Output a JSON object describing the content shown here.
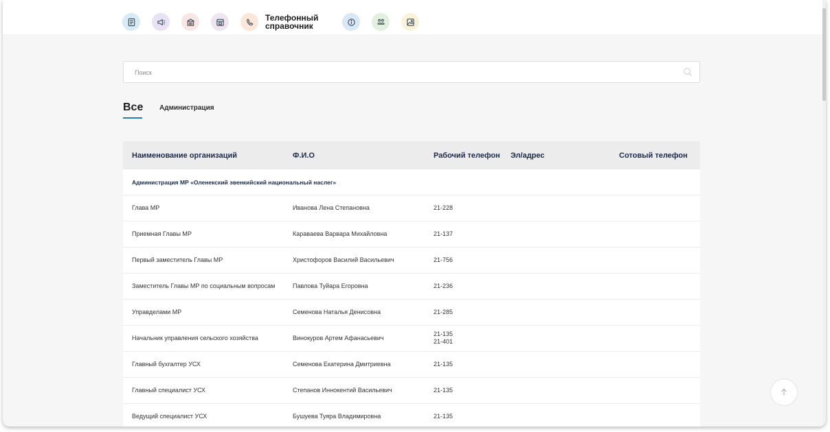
{
  "nav": {
    "items": [
      {
        "name": "documents-icon",
        "bg": "#d6ebf3"
      },
      {
        "name": "megaphone-icon",
        "bg": "#e8e2f4"
      },
      {
        "name": "building-icon",
        "bg": "#f7e6e4"
      },
      {
        "name": "calendar-icon",
        "bg": "#ede6f1"
      },
      {
        "name": "phone-icon",
        "bg": "#fbe7d8",
        "label": "Телефонный справочник"
      },
      {
        "name": "info-icon",
        "bg": "#d9e7f6"
      },
      {
        "name": "people-icon",
        "bg": "#e2f0df"
      },
      {
        "name": "image-icon",
        "bg": "#fbf3d9"
      }
    ]
  },
  "search": {
    "placeholder": "Поиск"
  },
  "tabs": {
    "all": "Все",
    "admin": "Администрация"
  },
  "table": {
    "headers": {
      "org": "Наименование организаций",
      "fio": "Ф.И.О",
      "work_phone": "Рабочий телефон",
      "email": "Эл/адрес",
      "mobile": "Сотовый телефон"
    },
    "group_title": "Администрация МР «Оленекский эвенкийский национальный наслег»",
    "rows": [
      {
        "org": "Глава МР",
        "fio": "Иванова Лена Степановна",
        "phone": "21-228",
        "phone2": ""
      },
      {
        "org": "Приемная Главы МР",
        "fio": "Караваева Варвара Михайловна",
        "phone": "21-137",
        "phone2": ""
      },
      {
        "org": "Первый заместитель Главы МР",
        "fio": "Христофоров Василий Васильевич",
        "phone": "21-756",
        "phone2": ""
      },
      {
        "org": "Заместитель Главы МР по социальным вопросам",
        "fio": "Павлова Туйара Егоровна",
        "phone": "21-236",
        "phone2": ""
      },
      {
        "org": "Управделами МР",
        "fio": "Семенова Наталья Денисовна",
        "phone": "21-285",
        "phone2": ""
      },
      {
        "org": "Начальник управления сельского хозяйства",
        "fio": "Винокуров Артем Афанасьевич",
        "phone": "21-135",
        "phone2": "21-401"
      },
      {
        "org": "Главный бухгалтер УСХ",
        "fio": "Семенова Екатерина Дмитриевна",
        "phone": "21-135",
        "phone2": ""
      },
      {
        "org": "Главный специалист УСХ",
        "fio": "Степанов Иннокентий Васильевич",
        "phone": "21-135",
        "phone2": ""
      },
      {
        "org": "Ведущий специалист УСХ",
        "fio": "Бушуева Туяра Владимировна",
        "phone": "21-135",
        "phone2": ""
      }
    ]
  },
  "colors": {
    "accent": "#2a7db3",
    "header_text": "#1a2a4a"
  }
}
